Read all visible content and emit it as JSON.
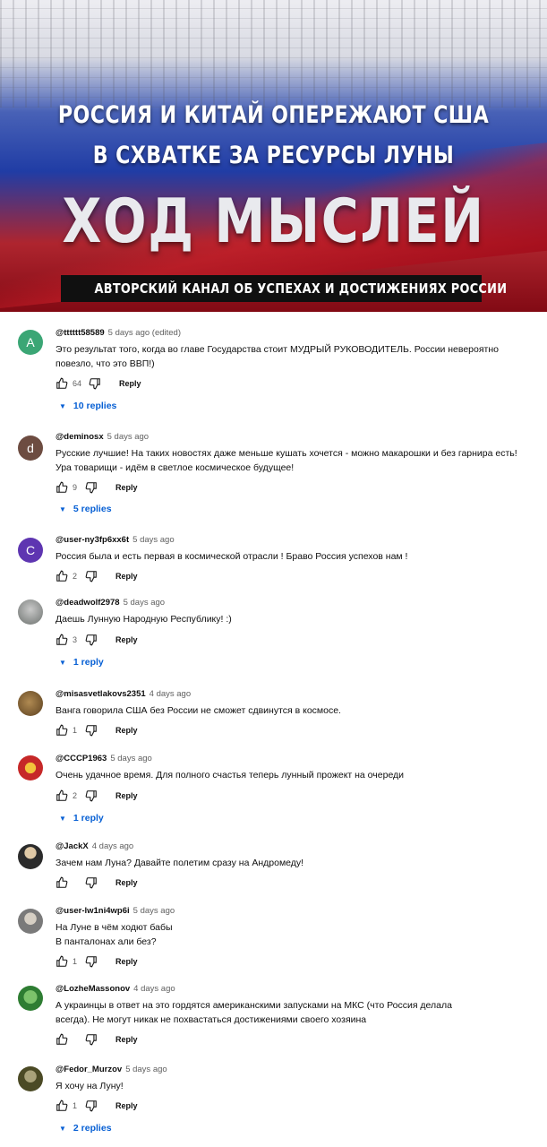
{
  "banner": {
    "headline_line1": "РОССИЯ И КИТАЙ ОПЕРЕЖАЮТ США",
    "headline_line2": "В СХВАТКЕ ЗА РЕСУРСЫ ЛУНЫ",
    "channel_name": "ХОД МЫСЛЕЙ",
    "tagline": "АВТОРСКИЙ КАНАЛ ОБ УСПЕХАХ И ДОСТИЖЕНИЯХ РОССИИ"
  },
  "actions": {
    "reply_label": "Reply"
  },
  "comments": [
    {
      "handle": "@tttttt58589",
      "time": "5 days ago (edited)",
      "avatar_letter": "A",
      "avatar_color": "#3ba675",
      "text": "Это результат того, когда во главе Государства стоит МУДРЫЙ РУКОВОДИТЕЛЬ. России невероятно повезло, что это ВВП!)",
      "likes": "64",
      "replies": "10 replies"
    },
    {
      "handle": "@deminosx",
      "time": "5 days ago",
      "avatar_letter": "d",
      "avatar_color": "#6d4c41",
      "text": "Русские лучшие! На таких новостях даже меньше кушать хочется - можно макарошки и без гарнира есть! Ура товарищи - идём в светлое космическое будущее!",
      "likes": "9",
      "replies": "5 replies"
    },
    {
      "handle": "@user-ny3fp6xx6t",
      "time": "5 days ago",
      "avatar_letter": "C",
      "avatar_color": "#5e35b1",
      "text": "Россия была и есть первая в космической отрасли ! Браво Россия успехов нам !",
      "likes": "2",
      "replies": ""
    },
    {
      "handle": "@deadwolf2978",
      "time": "5 days ago",
      "avatar_letter": "",
      "avatar_color": "#8a8f8c",
      "text": "Даешь Лунную Народную Республику! :)",
      "likes": "3",
      "replies": "1 reply"
    },
    {
      "handle": "@misasvetlakovs2351",
      "time": "4 days ago",
      "avatar_letter": "",
      "avatar_color": "#7b5a2e",
      "text": "Ванга говорила США без России не сможет сдвинутся в космосе.",
      "likes": "1",
      "replies": ""
    },
    {
      "handle": "@CCCP1963",
      "time": "5 days ago",
      "avatar_letter": "",
      "avatar_color": "#c62828",
      "text": "Очень удачное время. Для полного счастья теперь лунный прожект на очереди",
      "likes": "2",
      "replies": "1 reply"
    },
    {
      "handle": "@JackX",
      "time": "4 days ago",
      "avatar_letter": "",
      "avatar_color": "#4e4e4e",
      "text": "Зачем нам Луна? Давайте полетим сразу на Андромеду!",
      "likes": "",
      "replies": ""
    },
    {
      "handle": "@user-lw1ni4wp6i",
      "time": "5 days ago",
      "avatar_letter": "",
      "avatar_color": "#9e9e9e",
      "text": "На Луне в чём ходют бабы\nВ панталонах али без?",
      "likes": "1",
      "replies": ""
    },
    {
      "handle": "@LozheMassonov",
      "time": "4 days ago",
      "avatar_letter": "",
      "avatar_color": "#2e7d32",
      "text": "А украинцы в ответ на это гордятся американскими запусками на МКС (что Россия делала всегда). Не могут никак не похвастаться достижениями своего хозяина",
      "likes": "",
      "replies": ""
    },
    {
      "handle": "@Fedor_Murzov",
      "time": "5 days ago",
      "avatar_letter": "",
      "avatar_color": "#6b6b3a",
      "text": "Я хочу на Луну!",
      "likes": "1",
      "replies": "2 replies"
    }
  ]
}
